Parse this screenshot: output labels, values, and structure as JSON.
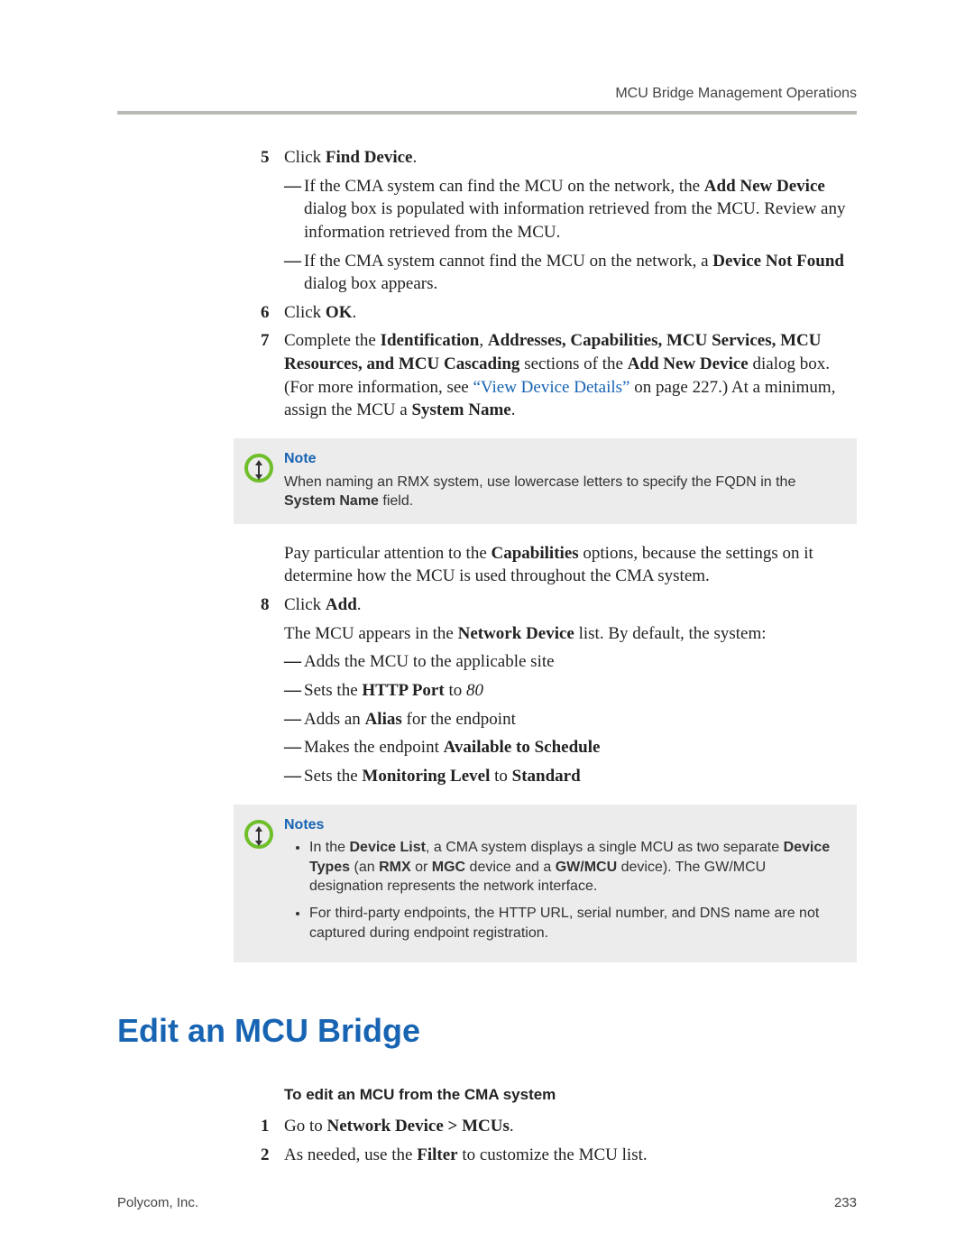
{
  "header": "MCU Bridge Management Operations",
  "step5": {
    "num": "5",
    "prefix": "Click ",
    "bold": "Find Device",
    "suffix": "."
  },
  "step5_sub1": {
    "a": "If the CMA system can find the MCU on the network, the ",
    "b": "Add New Device",
    "c": " dialog box is populated with information retrieved from the MCU. Review any information retrieved from the MCU."
  },
  "step5_sub2": {
    "a": "If the CMA system cannot find the MCU on the network, a ",
    "b": "Device Not Found",
    "c": " dialog box appears."
  },
  "step6": {
    "num": "6",
    "prefix": "Click ",
    "bold": "OK",
    "suffix": "."
  },
  "step7": {
    "num": "7",
    "a": "Complete the ",
    "b": "Identification",
    "c": ", ",
    "d": "Addresses, Capabilities, MCU Services, MCU Resources, and MCU Cascading",
    "e": " sections of the ",
    "f": "Add New Device",
    "g": " dialog box. (For more information, see ",
    "link": "“View Device Details”",
    "h": " on page 227.) At a minimum, assign the MCU a ",
    "i": "System Name",
    "j": "."
  },
  "note1": {
    "title": "Note",
    "a": "When naming an RMX system, use lowercase letters to specify the FQDN in the ",
    "b": "System Name",
    "c": " field."
  },
  "para_caps": {
    "a": "Pay particular attention to the ",
    "b": "Capabilities",
    "c": " options, because the settings on it determine how the MCU is used throughout the CMA system."
  },
  "step8": {
    "num": "8",
    "prefix": "Click ",
    "bold": "Add",
    "suffix": "."
  },
  "step8_intro": {
    "a": "The MCU appears in the ",
    "b": "Network Device",
    "c": " list. By default, the system:"
  },
  "step8_sub1": "Adds the MCU to the applicable site",
  "step8_sub2": {
    "a": "Sets the ",
    "b": "HTTP Port",
    "c": " to ",
    "d": "80"
  },
  "step8_sub3": {
    "a": "Adds an ",
    "b": "Alias",
    "c": " for the endpoint"
  },
  "step8_sub4": {
    "a": "Makes the endpoint ",
    "b": "Available to Schedule"
  },
  "step8_sub5": {
    "a": "Sets the ",
    "b": "Monitoring Level",
    "c": " to ",
    "d": "Standard"
  },
  "note2": {
    "title": "Notes",
    "li1": {
      "a": "In the ",
      "b": "Device List",
      "c": ", a CMA system displays a single MCU as two separate ",
      "d": "Device Types",
      "e": " (an ",
      "f": "RMX",
      "g": " or ",
      "h": "MGC",
      "i": " device and a ",
      "j": "GW/MCU",
      "k": " device). The GW/MCU designation represents the network interface."
    },
    "li2": "For third-party endpoints, the HTTP URL, serial number, and DNS name are not captured during endpoint registration."
  },
  "section_title": "Edit an MCU Bridge",
  "proc_title": "To edit an MCU from the CMA system",
  "ed1": {
    "num": "1",
    "a": "Go to ",
    "b": "Network Device > MCUs",
    "c": "."
  },
  "ed2": {
    "num": "2",
    "a": "As needed, use the ",
    "b": "Filter",
    "c": " to customize the MCU list."
  },
  "footer_left": "Polycom, Inc.",
  "footer_right": "233"
}
